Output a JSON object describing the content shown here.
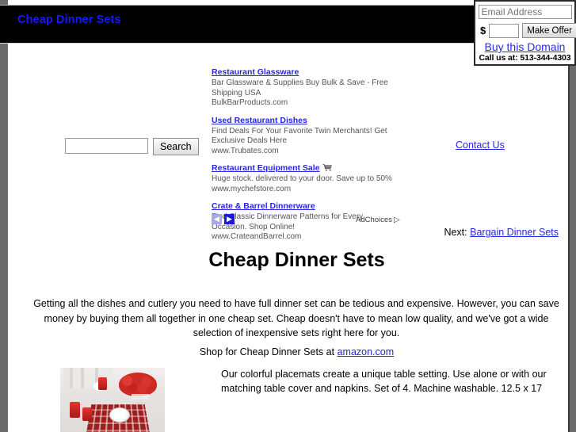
{
  "header": {
    "site_title": "Cheap Dinner Sets"
  },
  "domain_box": {
    "email_placeholder": "Email Address",
    "email_value": "",
    "dollar_sign": "$",
    "offer_amount_value": "",
    "make_offer_label": "Make Offer",
    "buy_domain_label": "Buy this Domain",
    "call_us_text": "Call us at: 513-344-4303"
  },
  "search": {
    "value": "",
    "placeholder": "",
    "button_label": "Search"
  },
  "ads": {
    "units": [
      {
        "title": "Restaurant Glassware",
        "desc": "Bar Glassware & Supplies Buy Bulk & Save - Free Shipping USA",
        "url": "BulkBarProducts.com",
        "icon": ""
      },
      {
        "title": "Used Restaurant Dishes",
        "desc": "Find Deals For Your Favorite Twin Merchants! Get Exclusive Deals Here",
        "url": "www.Trubates.com",
        "icon": ""
      },
      {
        "title": "Restaurant Equipment Sale",
        "desc": "Huge stock. delivered to your door. Save up to 50%",
        "url": "www.mychefstore.com",
        "icon": "shopping-cart-icon"
      },
      {
        "title": "Crate & Barrel Dinnerware",
        "desc": "Find Classic Dinnerware Patterns for Every Occasion. Shop Online!",
        "url": "www.CrateandBarrel.com",
        "icon": ""
      }
    ],
    "prev_arrow": "◀",
    "next_arrow": "▶",
    "adchoices_label": "AdChoices",
    "adchoices_icon": "▷"
  },
  "contact": {
    "label": "Contact Us"
  },
  "next_nav": {
    "prefix": "Next:",
    "link_label": "Bargain Dinner Sets"
  },
  "main": {
    "heading": "Cheap Dinner Sets",
    "intro_paragraph": "Getting all the dishes and cutlery you need to have full dinner set can be tedious and expensive. However, you can save money by buying them all together in one cheap set. Cheap doesn't have to mean low quality, and we've got a wide selection of inexpensive sets right here for you.",
    "shop_prefix": "Shop for Cheap Dinner Sets at",
    "shop_link_label": "amazon.com"
  },
  "product": {
    "image_alt": "red-placemat-table-setting-photo",
    "description": "Our colorful placemats create a unique table setting. Use alone or with our matching table cover and napkins. Set of 4. Machine washable. 12.5 x 17"
  },
  "colors": {
    "link_blue": "#2626e0",
    "title_blue": "#1818ff",
    "header_black": "#000000",
    "page_background": "#6b6b6b",
    "content_background": "#ffffff",
    "ad_text_gray": "#555555",
    "product_red": "#9e1d1d"
  }
}
